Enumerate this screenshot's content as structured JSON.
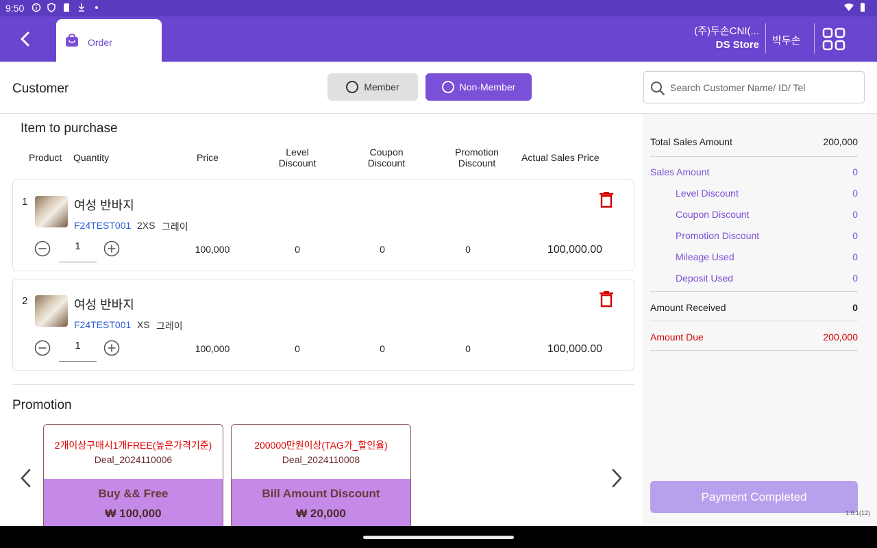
{
  "status_bar": {
    "time": "9:50"
  },
  "header": {
    "tab_label": "Order",
    "company": "(주)두손CNI(...",
    "store": "DS Store",
    "user": "박두손"
  },
  "customer": {
    "title": "Customer",
    "member_label": "Member",
    "non_member_label": "Non-Member",
    "selected": "Non-Member",
    "search_placeholder": "Search Customer Name/ ID/ Tel"
  },
  "items_section": {
    "title": "Item to purchase",
    "columns": {
      "product": "Product",
      "quantity": "Quantity",
      "price": "Price",
      "level_discount_1": "Level",
      "level_discount_2": "Discount",
      "coupon_discount_1": "Coupon",
      "coupon_discount_2": "Discount",
      "promotion_discount_1": "Promotion",
      "promotion_discount_2": "Discount",
      "actual_sales_price": "Actual Sales Price"
    },
    "items": [
      {
        "index": "1",
        "name": "여성 반바지",
        "code": "F24TEST001",
        "size": "2XS",
        "color": "그레이",
        "quantity": "1",
        "price": "100,000",
        "level_discount": "0",
        "coupon_discount": "0",
        "promotion_discount": "0",
        "actual_price": "100,000.00"
      },
      {
        "index": "2",
        "name": "여성 반바지",
        "code": "F24TEST001",
        "size": "XS",
        "color": "그레이",
        "quantity": "1",
        "price": "100,000",
        "level_discount": "0",
        "coupon_discount": "0",
        "promotion_discount": "0",
        "actual_price": "100,000.00"
      }
    ]
  },
  "promotion": {
    "title": "Promotion",
    "cards": [
      {
        "title": "2개이상구매시1개FREE(높은가격기준)",
        "code": "Deal_2024110006",
        "type": "Buy && Free",
        "amount": "₩ 100,000"
      },
      {
        "title": "200000만원이상(TAG가_할인율)",
        "code": "Deal_2024110008",
        "type": "Bill Amount Discount",
        "amount": "₩ 20,000"
      }
    ]
  },
  "summary": {
    "total_sales_label": "Total Sales Amount",
    "total_sales_value": "200,000",
    "sales_amount_label": "Sales Amount",
    "sales_amount_value": "0",
    "level_discount_label": "Level Discount",
    "level_discount_value": "0",
    "coupon_discount_label": "Coupon Discount",
    "coupon_discount_value": "0",
    "promotion_discount_label": "Promotion Discount",
    "promotion_discount_value": "0",
    "mileage_used_label": "Mileage Used",
    "mileage_used_value": "0",
    "deposit_used_label": "Deposit Used",
    "deposit_used_value": "0",
    "amount_received_label": "Amount Received",
    "amount_received_value": "0",
    "amount_due_label": "Amount Due",
    "amount_due_value": "200,000",
    "pay_button": "Payment Completed",
    "version": "1.0.1(12)"
  },
  "colors": {
    "primary": "#6a45cf",
    "accent": "#7b50d8",
    "danger": "#d40000",
    "promo_fill": "#c58ae8"
  }
}
